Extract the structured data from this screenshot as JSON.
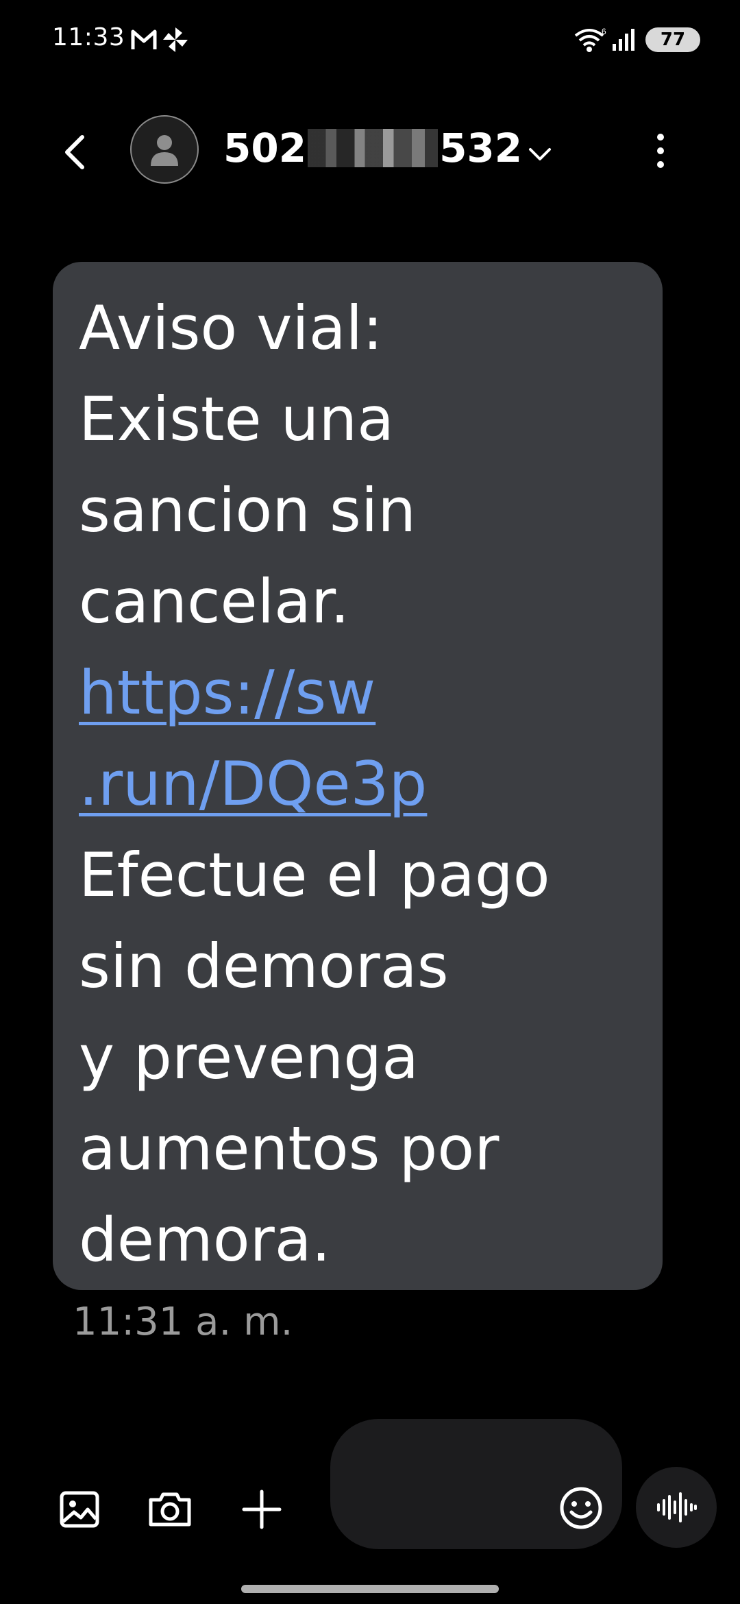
{
  "status_bar": {
    "time": "11:33",
    "battery": "77",
    "icons": [
      "gmail-icon",
      "pinwheel-app-icon",
      "wifi-icon",
      "signal-icon",
      "battery-icon"
    ]
  },
  "header": {
    "contact_prefix": "502",
    "contact_suffix": "532",
    "icons": [
      "back-arrow-icon",
      "person-icon",
      "chevron-down-icon",
      "more-vert-icon"
    ]
  },
  "message": {
    "lines_before_link": [
      "Aviso vial:",
      "Existe una",
      "sancion sin",
      "cancelar."
    ],
    "link_lines": [
      "https://sw",
      ".run/DQe3p"
    ],
    "lines_after_link": [
      "Efectue el pago",
      "sin demoras",
      "y prevenga",
      "aumentos por",
      "demora."
    ],
    "time": "11:31 a. m."
  },
  "composer": {
    "icons": [
      "gallery-icon",
      "camera-icon",
      "plus-icon",
      "emoji-icon",
      "voice-wave-icon"
    ]
  },
  "colors": {
    "background": "#000000",
    "bubble": "#3b3d41",
    "link": "#6f9ff0",
    "timestamp": "#9b9b9b"
  }
}
